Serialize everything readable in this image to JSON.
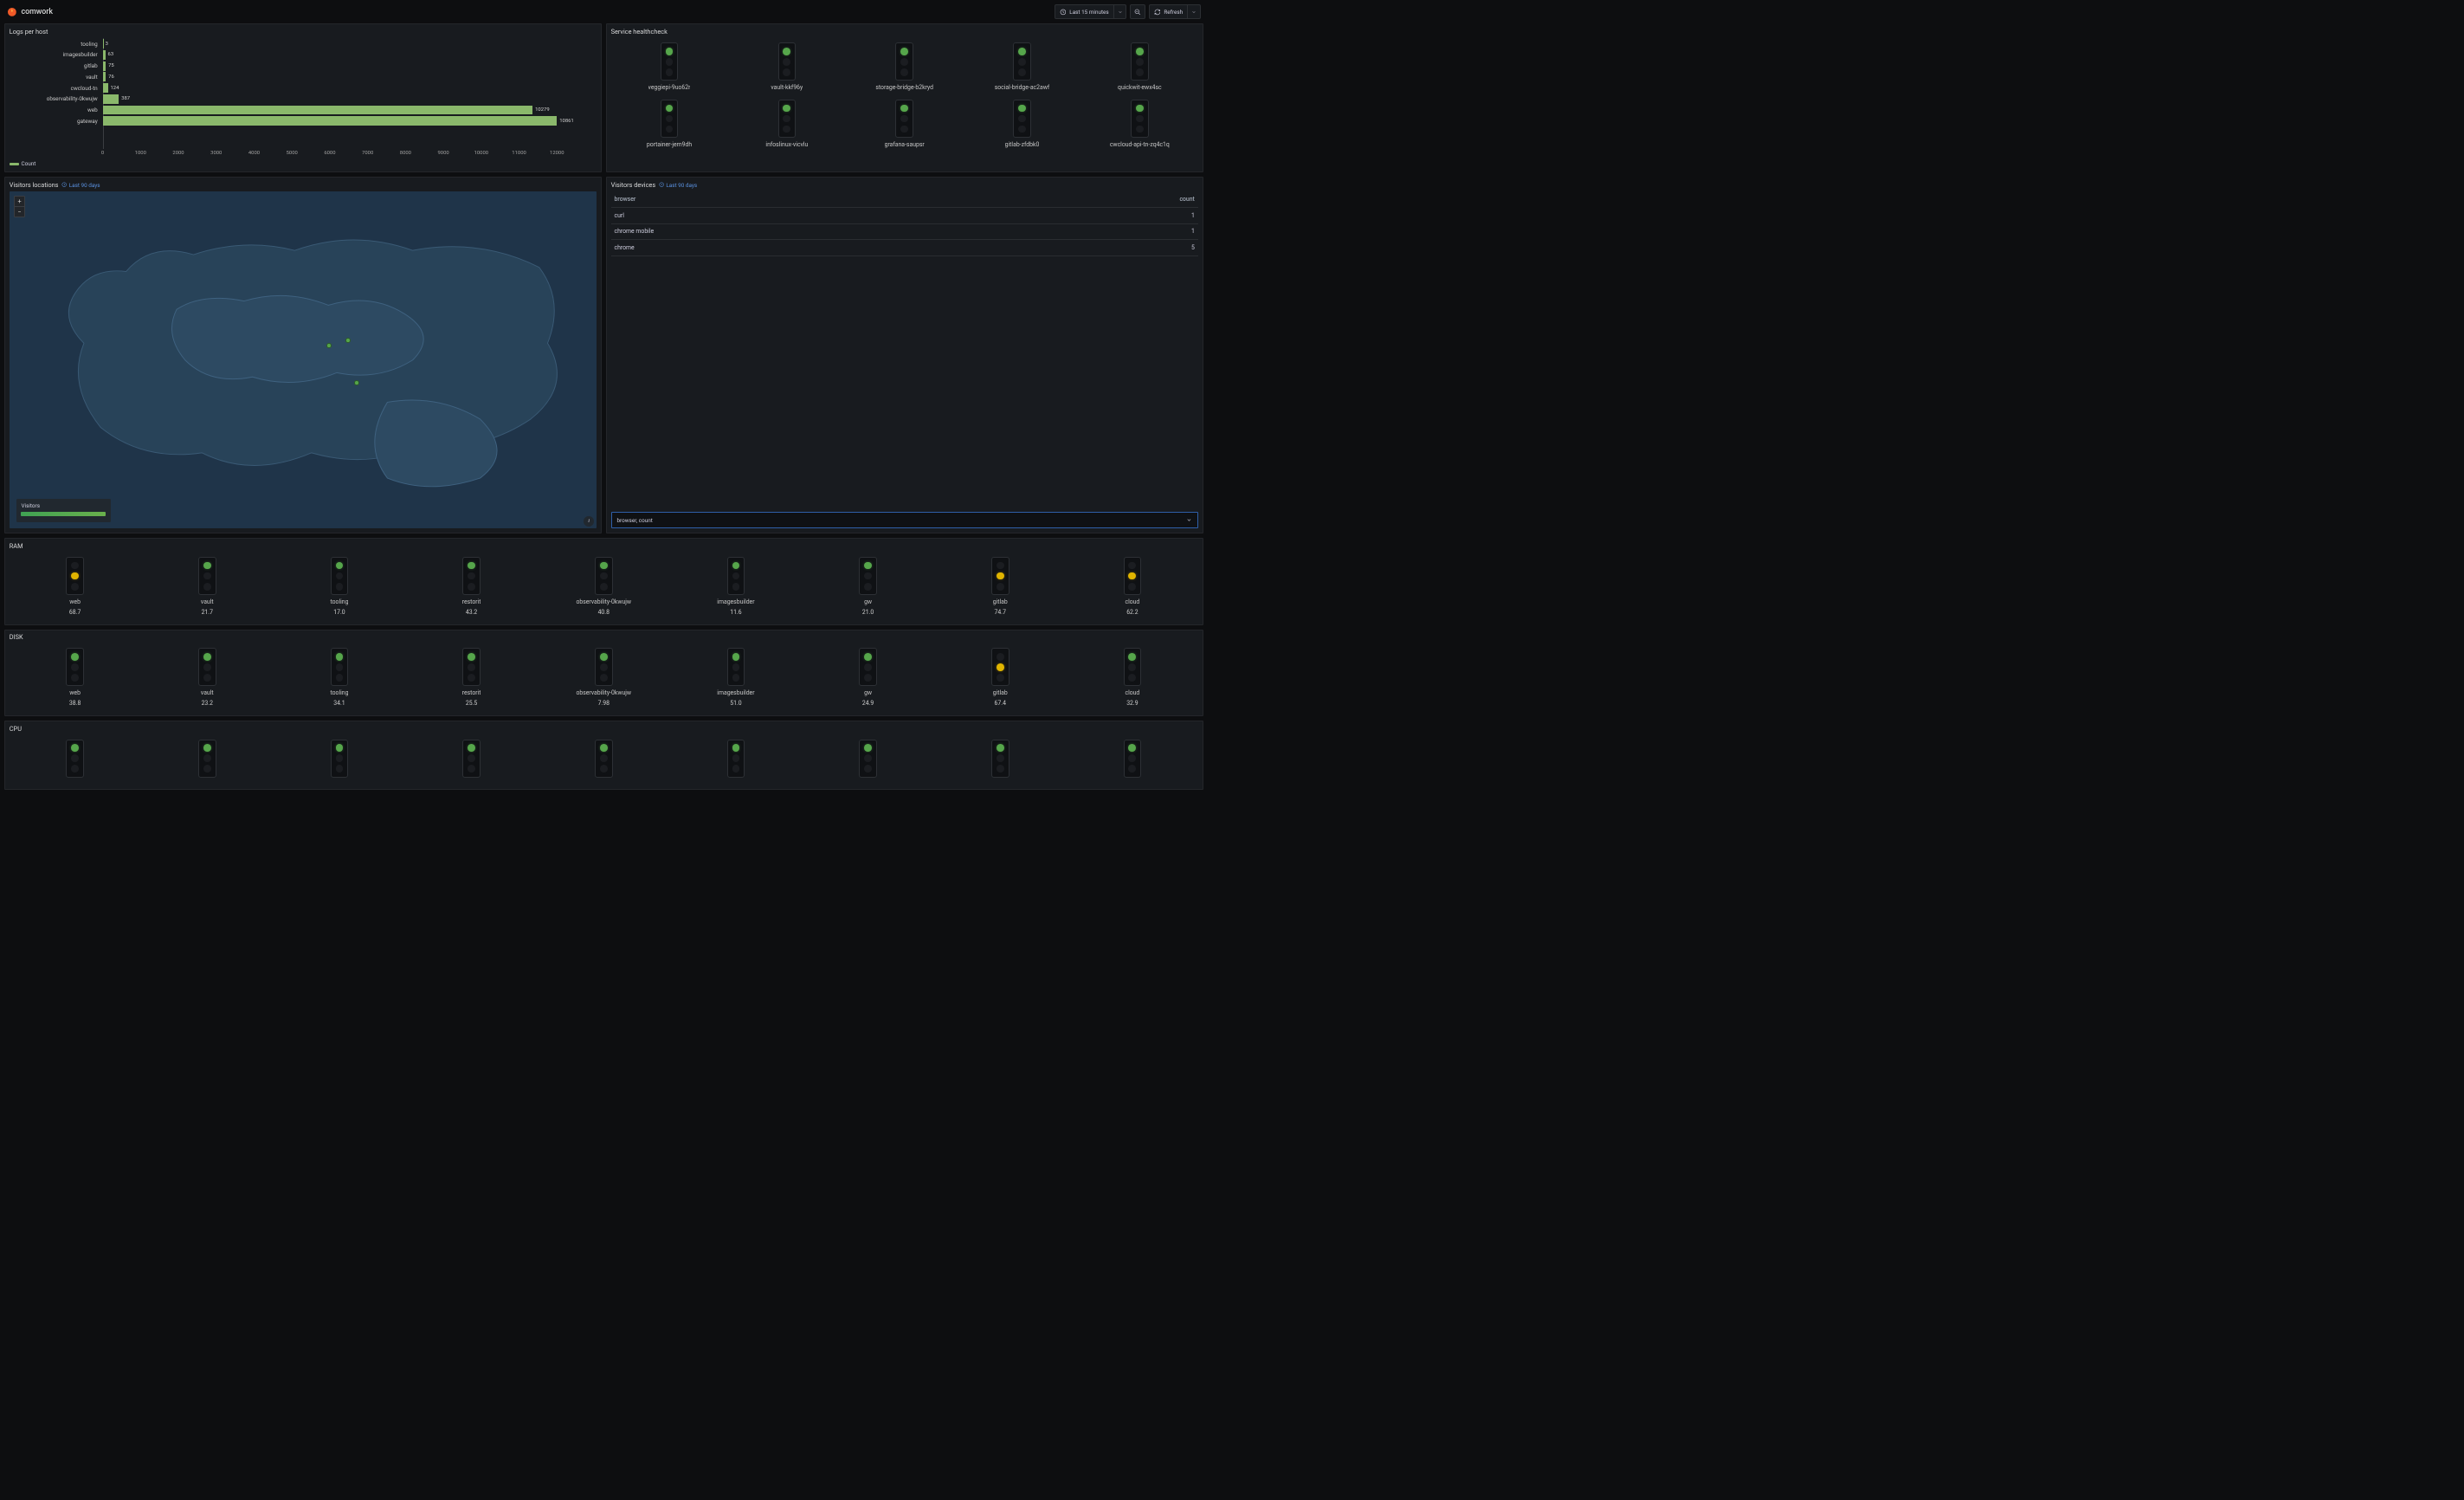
{
  "header": {
    "title": "comwork",
    "time_range": "Last 15 minutes",
    "refresh_label": "Refresh"
  },
  "chart_data": {
    "type": "bar",
    "orientation": "horizontal",
    "title": "Logs per host",
    "categories": [
      "tooling",
      "imagesbuilder",
      "gitlab",
      "vault",
      "cwcloud-tn",
      "observability-0kwujw",
      "web",
      "gateway"
    ],
    "values": [
      3,
      63,
      75,
      76,
      124,
      387,
      10279,
      10861
    ],
    "xticks": [
      0,
      1000,
      2000,
      3000,
      4000,
      5000,
      6000,
      7000,
      8000,
      9000,
      10000,
      11000,
      12000
    ],
    "legend": "Count",
    "xlabel": "",
    "ylabel": ""
  },
  "healthcheck": {
    "title": "Service healthcheck",
    "items": [
      {
        "name": "veggiepi-9uo62r",
        "status": "green"
      },
      {
        "name": "vault-kkf96y",
        "status": "green"
      },
      {
        "name": "storage-bridge-b2kryd",
        "status": "green"
      },
      {
        "name": "social-bridge-ac2awf",
        "status": "green"
      },
      {
        "name": "quickwit-ewx4sc",
        "status": "green"
      },
      {
        "name": "portainer-jem9dh",
        "status": "green"
      },
      {
        "name": "infoslinux-vicvlu",
        "status": "green"
      },
      {
        "name": "grafana-saupsr",
        "status": "green"
      },
      {
        "name": "gitlab-zfdbk0",
        "status": "green"
      },
      {
        "name": "cwcloud-api-tn-zq4c1q",
        "status": "green"
      }
    ]
  },
  "visitors_locations": {
    "title": "Visitors locations",
    "range": "Last 90 days",
    "legend_title": "Visitors",
    "points": [
      {
        "x": 54,
        "y": 45
      },
      {
        "x": 57.2,
        "y": 43.5
      },
      {
        "x": 58.7,
        "y": 56
      }
    ]
  },
  "visitors_devices": {
    "title": "Visitors devices",
    "range": "Last 90 days",
    "columns": [
      "browser",
      "count"
    ],
    "rows": [
      {
        "browser": "curl",
        "count": "1"
      },
      {
        "browser": "chrome mobile",
        "count": "1"
      },
      {
        "browser": "chrome",
        "count": "5"
      }
    ],
    "select_value": "browser, count"
  },
  "ram": {
    "title": "RAM",
    "items": [
      {
        "name": "web",
        "value": "68.7",
        "status": "yellow"
      },
      {
        "name": "vault",
        "value": "21.7",
        "status": "green"
      },
      {
        "name": "tooling",
        "value": "17.0",
        "status": "green"
      },
      {
        "name": "restorit",
        "value": "43.2",
        "status": "green"
      },
      {
        "name": "observability-0kwujw",
        "value": "40.8",
        "status": "green"
      },
      {
        "name": "imagesbuilder",
        "value": "11.6",
        "status": "green"
      },
      {
        "name": "gw",
        "value": "21.0",
        "status": "green"
      },
      {
        "name": "gitlab",
        "value": "74.7",
        "status": "yellow"
      },
      {
        "name": "cloud",
        "value": "62.2",
        "status": "yellow"
      }
    ]
  },
  "disk": {
    "title": "DISK",
    "items": [
      {
        "name": "web",
        "value": "38.8",
        "status": "green"
      },
      {
        "name": "vault",
        "value": "23.2",
        "status": "green"
      },
      {
        "name": "tooling",
        "value": "34.1",
        "status": "green"
      },
      {
        "name": "restorit",
        "value": "25.5",
        "status": "green"
      },
      {
        "name": "observability-0kwujw",
        "value": "7.98",
        "status": "green"
      },
      {
        "name": "imagesbuilder",
        "value": "51.0",
        "status": "green"
      },
      {
        "name": "gw",
        "value": "24.9",
        "status": "green"
      },
      {
        "name": "gitlab",
        "value": "67.4",
        "status": "yellow"
      },
      {
        "name": "cloud",
        "value": "32.9",
        "status": "green"
      }
    ]
  },
  "cpu": {
    "title": "CPU",
    "items": [
      {
        "name": "",
        "value": "",
        "status": "green"
      },
      {
        "name": "",
        "value": "",
        "status": "green"
      },
      {
        "name": "",
        "value": "",
        "status": "green"
      },
      {
        "name": "",
        "value": "",
        "status": "green"
      },
      {
        "name": "",
        "value": "",
        "status": "green"
      },
      {
        "name": "",
        "value": "",
        "status": "green"
      },
      {
        "name": "",
        "value": "",
        "status": "green"
      },
      {
        "name": "",
        "value": "",
        "status": "green"
      },
      {
        "name": "",
        "value": "",
        "status": "green"
      }
    ]
  }
}
